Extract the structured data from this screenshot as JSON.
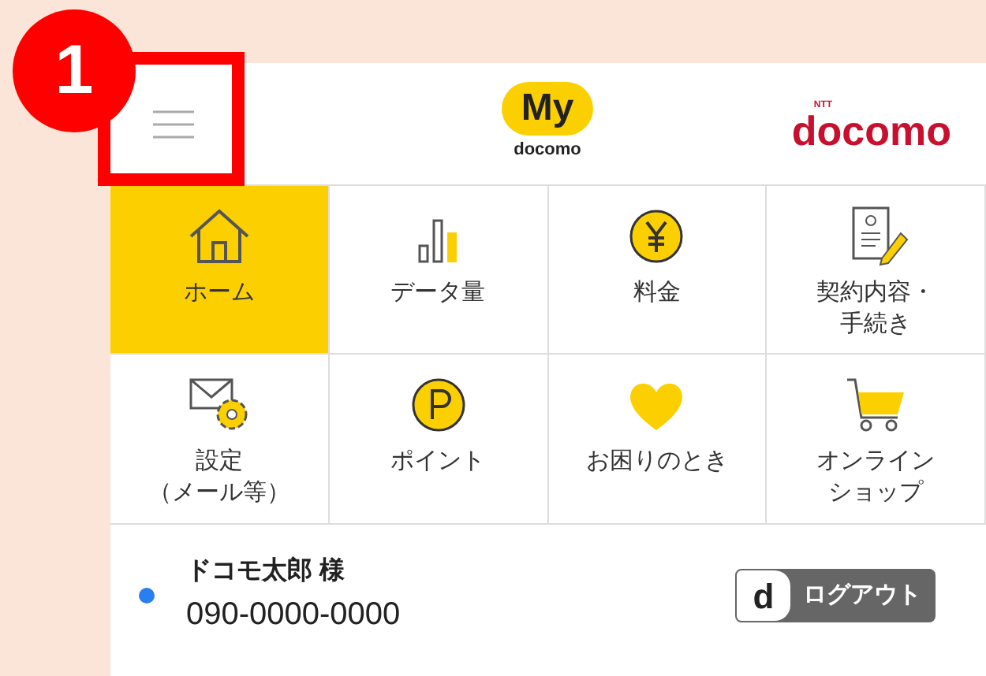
{
  "callout": {
    "number": "1"
  },
  "header": {
    "logo_text": "My",
    "logo_sub": "docomo",
    "brand_tag": "NTT",
    "brand": "docomo"
  },
  "menu": [
    {
      "label_lines": [
        "ホーム"
      ],
      "selected": true
    },
    {
      "label_lines": [
        "データ量"
      ],
      "selected": false
    },
    {
      "label_lines": [
        "料金"
      ],
      "selected": false
    },
    {
      "label_lines": [
        "契約内容・",
        "手続き"
      ],
      "selected": false
    },
    {
      "label_lines": [
        "設定",
        "（メール等）"
      ],
      "selected": false
    },
    {
      "label_lines": [
        "ポイント"
      ],
      "selected": false
    },
    {
      "label_lines": [
        "お困りのとき"
      ],
      "selected": false
    },
    {
      "label_lines": [
        "オンライン",
        "ショップ"
      ],
      "selected": false
    }
  ],
  "user": {
    "name": "ドコモ太郎 様",
    "number": "090-0000-0000",
    "color": "#2a7ff0",
    "logout_letter": "d",
    "logout": "ログアウト"
  }
}
